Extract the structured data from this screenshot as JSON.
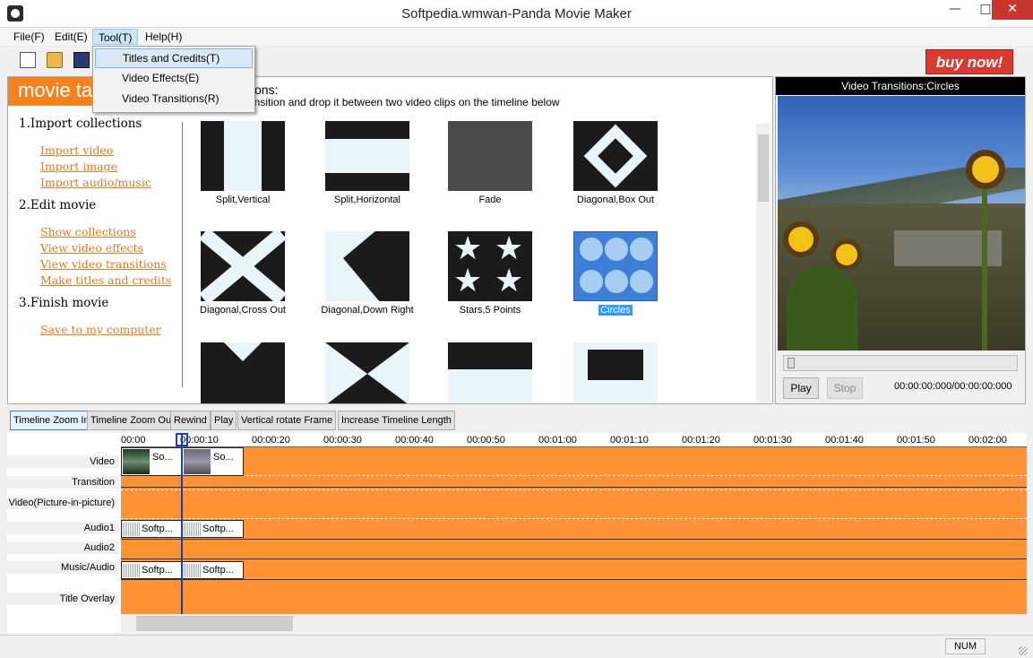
{
  "window": {
    "title": "Softpedia.wmwan-Panda Movie Maker",
    "minimize_icon": "minimize-icon",
    "maximize_icon": "maximize-icon",
    "close_icon": "close-icon"
  },
  "menubar": {
    "file": "File(F)",
    "edit": "Edit(E)",
    "tool": "Tool(T)",
    "help": "Help(H)"
  },
  "tool_menu": {
    "items": [
      "Titles and Credits(T)",
      "Video Effects(E)",
      "Video Transitions(R)"
    ],
    "highlighted": "Titles and Credits(T)"
  },
  "toolbar": {
    "icons": [
      "new-file-icon",
      "open-folder-icon",
      "save-disk-icon"
    ],
    "buy_now": "buy now!"
  },
  "tasks": {
    "header": "movie ta",
    "instruction_title": "tions:",
    "instruction_text": "ansition and drop it between two video clips on the timeline below",
    "sections": [
      {
        "heading": "1.Import collections",
        "links": [
          "Import video",
          "Import image",
          "Import audio/music"
        ]
      },
      {
        "heading": "2.Edit movie",
        "links": [
          "Show collections",
          "View video effects",
          "View video transitions",
          "Make titles and credits"
        ]
      },
      {
        "heading": "3.Finish movie",
        "links": [
          "Save to my computer"
        ]
      }
    ]
  },
  "transitions": {
    "row1": [
      "Split,Vertical",
      "Split,Horizontal",
      "Fade",
      "Diagonal,Box Out"
    ],
    "row2": [
      "Diagonal,Cross Out",
      "Diagonal,Down Right",
      "Stars,5 Points",
      "Circles"
    ],
    "selected": "Circles"
  },
  "preview": {
    "title": "Video Transitions:Circles",
    "play": "Play",
    "stop": "Stop",
    "time": "00:00:00:000/00:00:00:000"
  },
  "timeline_toolbar": {
    "zoom_in": "Timeline Zoom In",
    "zoom_out": "Timeline Zoom Out",
    "rewind": "Rewind",
    "play": "Play",
    "rotate": "Vertical rotate Frame",
    "increase": "Increase Timeline Length"
  },
  "timeline": {
    "ticks": [
      "00:00",
      "00:00:10",
      "00:00:20",
      "00:00:30",
      "00:00:40",
      "00:00:50",
      "00:01:00",
      "00:01:10",
      "00:01:20",
      "00:01:30",
      "00:01:40",
      "00:01:50",
      "00:02:00"
    ],
    "tracks": [
      "Video",
      "Transition",
      "Video(Picture-in-picture)",
      "Audio1",
      "Audio2",
      "Music/Audio",
      "Title Overlay"
    ],
    "video_clips": [
      "So...",
      "So..."
    ],
    "audio1_clips": [
      "Softp...",
      "Softp..."
    ],
    "music_clips": [
      "Softp...",
      "Softp..."
    ]
  },
  "status": {
    "num": "NUM"
  },
  "colors": {
    "accent_orange": "#f5821f",
    "timeline_orange": "#fe9234",
    "buy_red": "#d93b34",
    "selection_blue": "#3399ff"
  }
}
